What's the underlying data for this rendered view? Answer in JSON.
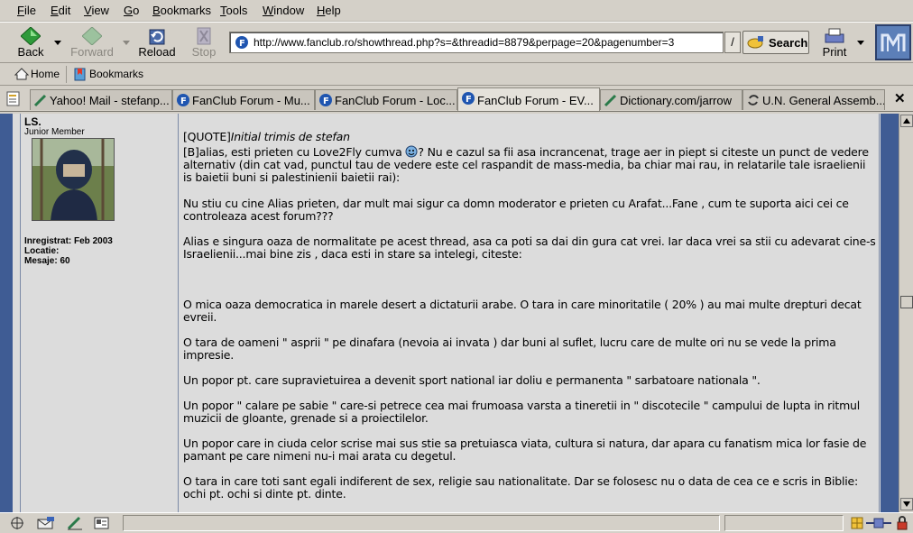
{
  "menu": [
    "File",
    "Edit",
    "View",
    "Go",
    "Bookmarks",
    "Tools",
    "Window",
    "Help"
  ],
  "menu_mnemonic": [
    "F",
    "E",
    "V",
    "G",
    "B",
    "T",
    "W",
    "H"
  ],
  "nav": {
    "back": "Back",
    "forward": "Forward",
    "reload": "Reload",
    "stop": "Stop",
    "url": "http://www.fanclub.ro/showthread.php?s=&threadid=8879&perpage=20&pagenumber=3",
    "search": "Search",
    "print": "Print"
  },
  "personal_toolbar": {
    "home": "Home",
    "bookmarks": "Bookmarks"
  },
  "tabs": [
    {
      "label": "Yahoo! Mail - stefanp...",
      "icon": "pen-icon",
      "active": false
    },
    {
      "label": "FanClub Forum - Mu...",
      "icon": "fanclub-icon",
      "active": false
    },
    {
      "label": "FanClub Forum - Loc...",
      "icon": "fanclub-icon",
      "active": false
    },
    {
      "label": "FanClub Forum - EV...",
      "icon": "fanclub-icon",
      "active": true
    },
    {
      "label": "Dictionary.com/jarrow",
      "icon": "pen-icon",
      "active": false
    },
    {
      "label": "U.N. General Assemb...",
      "icon": "loading-icon",
      "active": false
    }
  ],
  "colors": {
    "forum_blue": "#3f5c94",
    "post_bg": "#dcdcdc",
    "chrome": "#d4d0c8"
  },
  "user": {
    "name": "LS.",
    "rank": "Junior Member",
    "registered": "Inregistrat: Feb 2003",
    "location": "Locatie:",
    "posts": "Mesaje: 60"
  },
  "post": {
    "quote_tag": "[QUOTE]",
    "quote_header": "Initial trimis de stefan",
    "p1_a": "[B]alias, esti prieten cu Love2Fly cumva ",
    "p1_b": "? Nu e cazul sa fii asa incrancenat, trage aer in piept si citeste un punct de vedere alternativ (din cat vad, punctul tau de vedere este cel raspandit de mass-media, ba chiar mai rau, in relatarile tale israelienii is baietii buni si palestinienii baietii rai):",
    "p2": "Nu stiu cu cine Alias prieten, dar mult mai sigur ca domn moderator e prieten cu Arafat...Fane , cum te suporta aici cei ce controleaza acest forum???",
    "p3": "Alias e singura oaza de normalitate pe acest thread, asa ca poti sa dai din gura cat vrei. Iar daca vrei sa stii cu adevarat cine-s Israelienii...mai bine zis , daca esti in stare sa intelegi, citeste:",
    "p4": "O mica oaza democratica in marele desert a dictaturii arabe. O tara in care minoritatile ( 20% ) au mai multe drepturi decat evreii.",
    "p5": "O tara de oameni \" asprii \" pe dinafara (nevoia ai invata ) dar buni al suflet, lucru care de multe ori nu se vede la prima impresie.",
    "p6": "Un popor pt. care supravietuirea a devenit sport national iar doliu e permanenta \" sarbatoare nationala \".",
    "p7": "Un popor \" calare pe sabie \" care-si petrece cea mai frumoasa varsta a tineretii in \" discotecile \" campului de lupta in ritmul muzicii de gloante, grenade si a proiectilelor.",
    "p8": "Un popor care in ciuda celor scrise mai sus stie sa pretuiasca viata, cultura si natura, dar apara cu fanatism mica lor fasie de pamant pe care nimeni nu-i mai arata cu degetul.",
    "p9": "O tara in care toti sant egali indiferent de sex, religie sau nationalitate. Dar se folosesc nu o data de cea ce e scris in Biblie: ochi pt. ochi si dinte pt. dinte."
  },
  "scroll": {
    "position": 0.47
  }
}
